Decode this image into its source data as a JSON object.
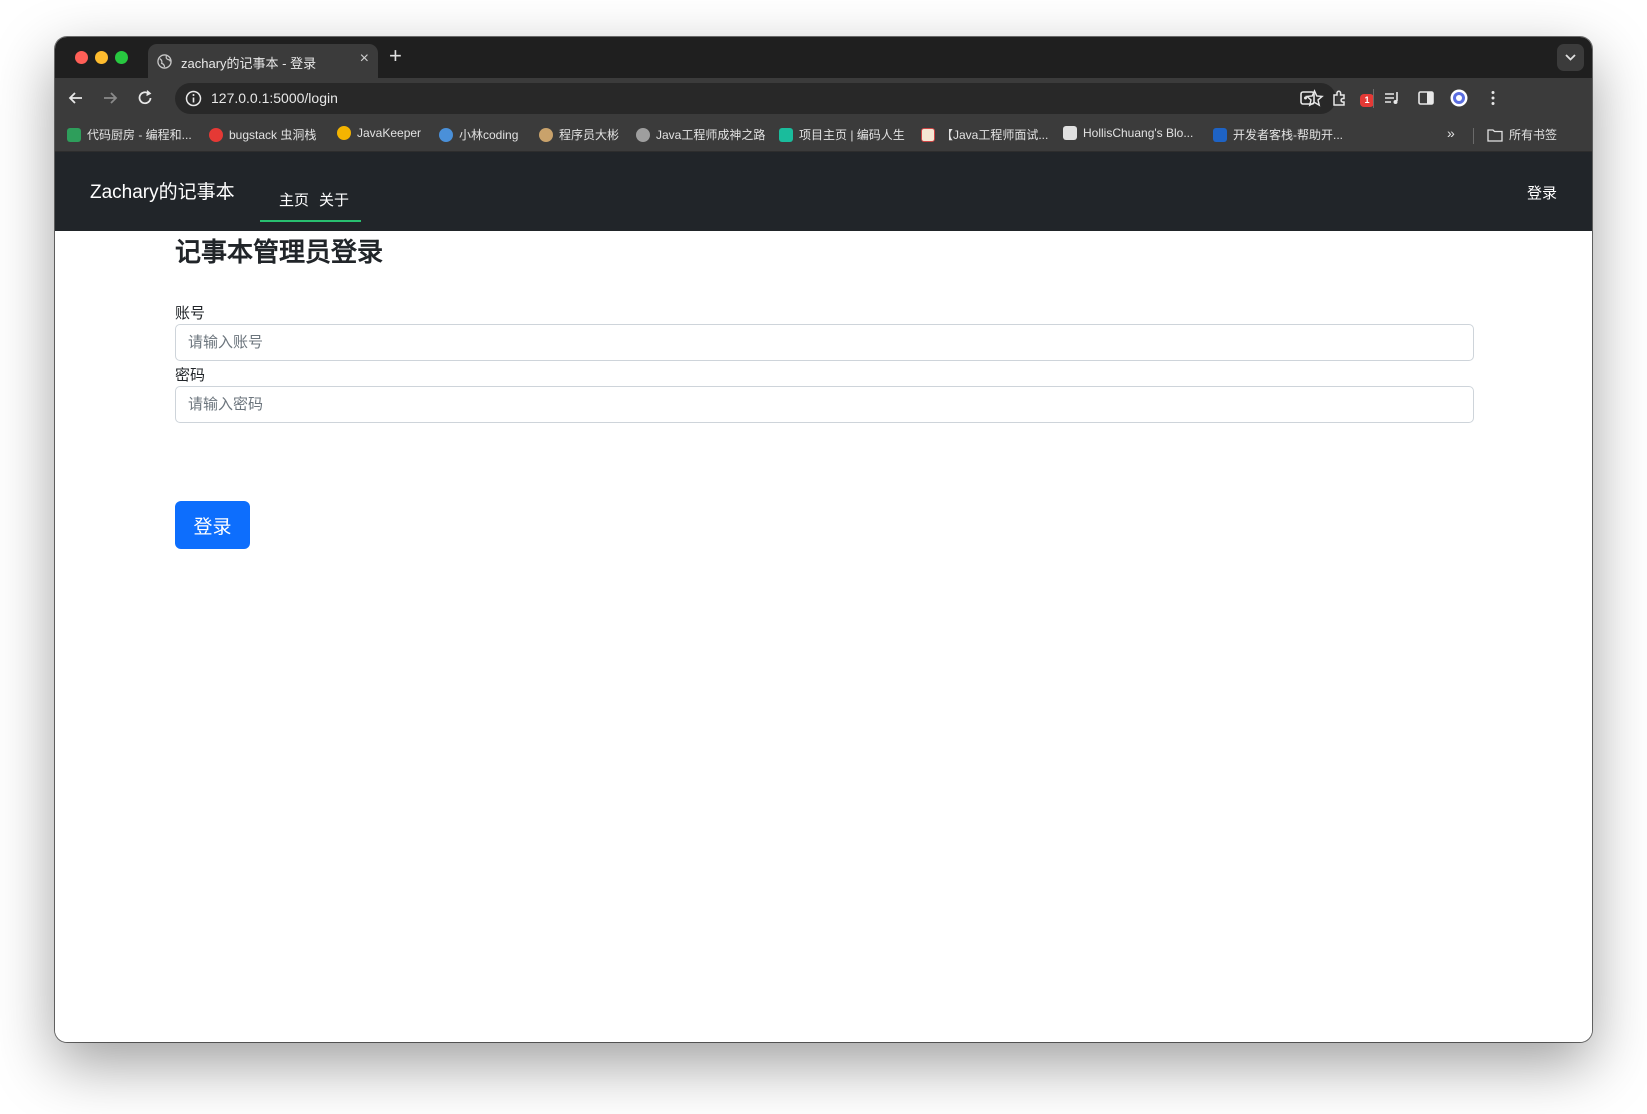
{
  "browser": {
    "tab_title": "zachary的记事本 - 登录",
    "new_tab_label": "+",
    "close_label": "×",
    "url": "127.0.0.1:5000/login",
    "extension_badge": "1",
    "bookmarks": [
      {
        "label": "代码厨房 - 编程和...",
        "icon_color": "#2e9e5b"
      },
      {
        "label": "bugstack 虫洞栈",
        "icon_color": "#e53935"
      },
      {
        "label": "JavaKeeper",
        "icon_color": "#f4b400"
      },
      {
        "label": "小林coding",
        "icon_color": "#4a90d9"
      },
      {
        "label": "程序员大彬",
        "icon_color": "#c9a26b"
      },
      {
        "label": "Java工程师成神之路",
        "icon_color": "#9e9e9e"
      },
      {
        "label": "项目主页 | 编码人生",
        "icon_color": "#1abc9c"
      },
      {
        "label": "【Java工程师面试...",
        "icon_color": "#f5e6d3"
      },
      {
        "label": "HollisChuang's Blo...",
        "icon_color": "#e0e0e0"
      },
      {
        "label": "开发者客栈-帮助开...",
        "icon_color": "#1e63c5"
      }
    ],
    "bookmarks_more": "»",
    "all_bookmarks": "所有书签"
  },
  "navbar": {
    "brand": "Zachary的记事本",
    "links": [
      "主页",
      "关于"
    ],
    "login_label": "登录",
    "underline_color": "#28c070"
  },
  "form": {
    "title": "记事本管理员登录",
    "account_label": "账号",
    "account_placeholder": "请输入账号",
    "password_label": "密码",
    "password_placeholder": "请输入密码",
    "submit_label": "登录",
    "submit_color": "#0d6efd"
  }
}
